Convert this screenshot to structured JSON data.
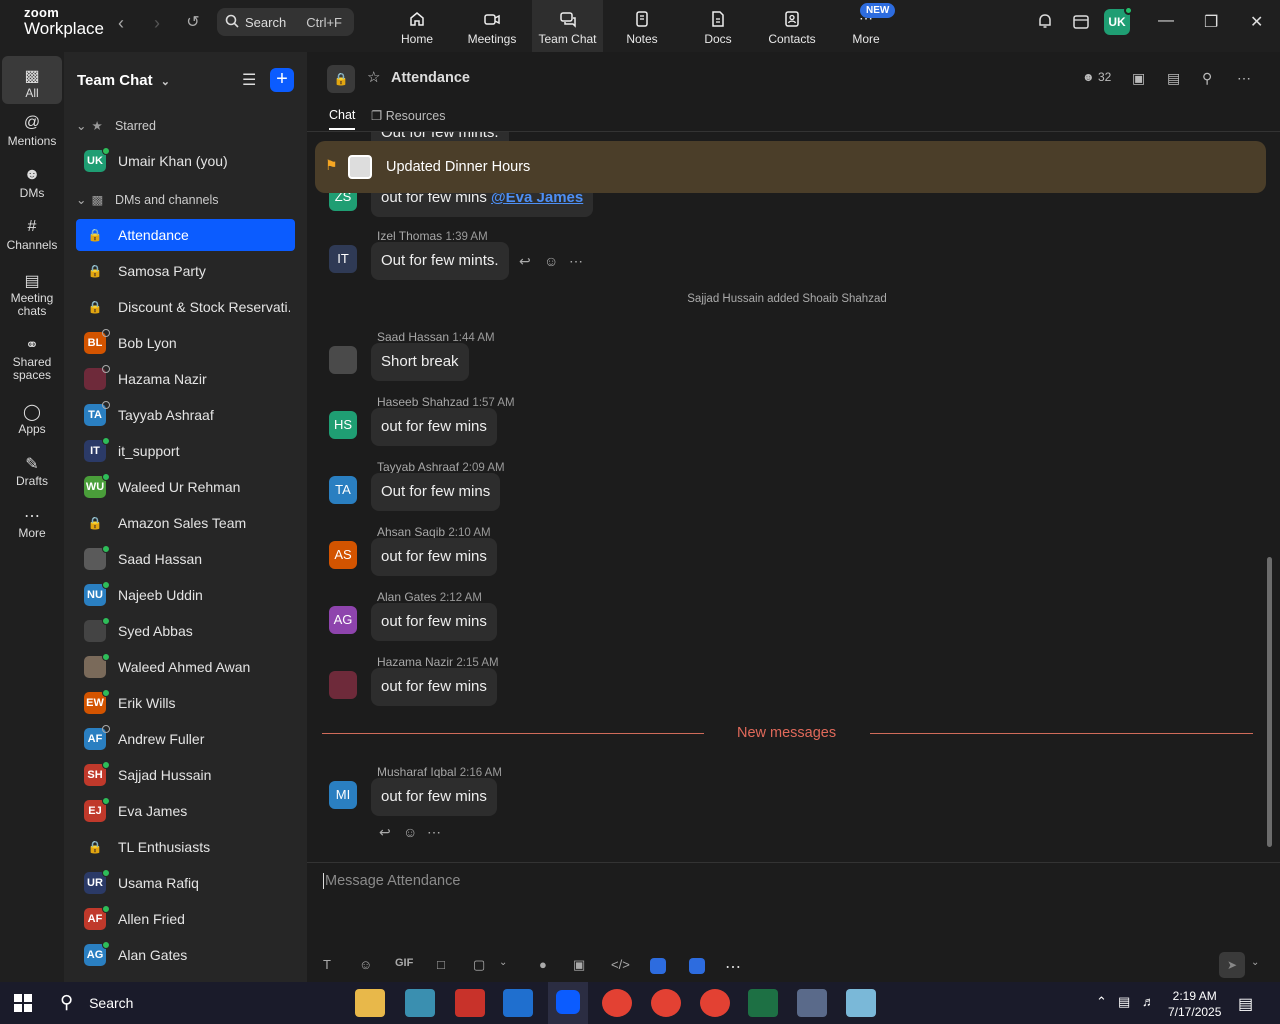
{
  "app": {
    "brand_line1": "zoom",
    "brand_line2": "Workplace",
    "search_label": "Search",
    "search_shortcut": "Ctrl+F",
    "tabs": [
      {
        "label": "Home",
        "icon": "home-icon"
      },
      {
        "label": "Meetings",
        "icon": "video-icon"
      },
      {
        "label": "Team Chat",
        "icon": "chat-icon"
      },
      {
        "label": "Notes",
        "icon": "notes-icon"
      },
      {
        "label": "Docs",
        "icon": "docs-icon"
      },
      {
        "label": "Contacts",
        "icon": "contacts-icon"
      },
      {
        "label": "More",
        "icon": "more-icon"
      }
    ],
    "new_badge": "NEW",
    "user_initials": "UK"
  },
  "rail": {
    "items": [
      {
        "label": "All",
        "icon": "chat-bubble-icon"
      },
      {
        "label": "Mentions",
        "icon": "at-icon"
      },
      {
        "label": "DMs",
        "icon": "people-icon"
      },
      {
        "label": "Channels",
        "icon": "hash-icon"
      },
      {
        "label": "Meeting chats",
        "icon": "calendar-icon"
      },
      {
        "label": "Shared spaces",
        "icon": "shared-icon"
      },
      {
        "label": "Apps",
        "icon": "apps-icon"
      },
      {
        "label": "Drafts",
        "icon": "drafts-icon"
      },
      {
        "label": "More",
        "icon": "ellipsis-icon"
      }
    ]
  },
  "sidebar": {
    "title": "Team Chat",
    "starred_label": "Starred",
    "dms_label": "DMs and channels",
    "starred": [
      {
        "name": "Umair Khan (you)",
        "initials": "UK",
        "color": "#1f9e73",
        "presence": "online"
      }
    ],
    "items": [
      {
        "name": "Attendance",
        "type": "channel",
        "active": true
      },
      {
        "name": "Samosa Party",
        "type": "channel"
      },
      {
        "name": "Discount & Stock Reservati...",
        "type": "channel"
      },
      {
        "name": "Bob Lyon",
        "initials": "BL",
        "color": "#d35400",
        "presence": "offline"
      },
      {
        "name": "Hazama Nazir",
        "initials": "",
        "color": "#6e2a3a",
        "presence": "offline"
      },
      {
        "name": "Tayyab Ashraaf",
        "initials": "TA",
        "color": "#2a7fc1",
        "presence": "offline"
      },
      {
        "name": "it_support",
        "initials": "IT",
        "color": "#2b3a67",
        "presence": "online"
      },
      {
        "name": "Waleed Ur Rehman",
        "initials": "WU",
        "color": "#4a9e3a",
        "presence": "online"
      },
      {
        "name": "Amazon Sales Team",
        "type": "channel"
      },
      {
        "name": "Saad Hassan",
        "initials": "",
        "color": "#5a5a5a",
        "presence": "online"
      },
      {
        "name": "Najeeb Uddin",
        "initials": "NU",
        "color": "#2a7fc1",
        "presence": "online"
      },
      {
        "name": "Syed Abbas",
        "initials": "",
        "color": "#444444",
        "presence": "online"
      },
      {
        "name": "Waleed Ahmed Awan",
        "initials": "",
        "color": "#7a6a5a",
        "presence": "online"
      },
      {
        "name": "Erik Wills",
        "initials": "EW",
        "color": "#d35400",
        "presence": "online"
      },
      {
        "name": "Andrew Fuller",
        "initials": "AF",
        "color": "#2a7fc1",
        "presence": "offline"
      },
      {
        "name": "Sajjad Hussain",
        "initials": "SH",
        "color": "#c0392b",
        "presence": "online"
      },
      {
        "name": "Eva James",
        "initials": "EJ",
        "color": "#c0392b",
        "presence": "online"
      },
      {
        "name": "TL Enthusiasts",
        "type": "channel"
      },
      {
        "name": "Usama Rafiq",
        "initials": "UR",
        "color": "#2b3a67",
        "presence": "online"
      },
      {
        "name": "Allen Fried",
        "initials": "AF",
        "color": "#c0392b",
        "presence": "online"
      },
      {
        "name": "Alan Gates",
        "initials": "AG",
        "color": "#2a7fc1",
        "presence": "online"
      }
    ]
  },
  "channel": {
    "title": "Attendance",
    "member_count": "32",
    "tab_chat": "Chat",
    "tab_resources": "Resources",
    "pinned": "Updated Dinner Hours",
    "partial_top": "Out for few mints.",
    "partial_mention_text": "out for few mins",
    "partial_mention": "@Eva James",
    "partial_initials": "ZS",
    "system_message": "Sajjad Hussain added Shoaib Shahzad",
    "new_messages_label": "New messages",
    "composer_placeholder": "Message Attendance",
    "messages": [
      {
        "sender": "Izel Thomas",
        "time": "1:39 AM",
        "text": "Out for few mints.",
        "initials": "IT",
        "color": "#2f3a55"
      },
      {
        "sender": "Saad Hassan",
        "time": "1:44 AM",
        "text": "Short break",
        "initials": "",
        "color": "#4a4a4a"
      },
      {
        "sender": "Haseeb Shahzad",
        "time": "1:57 AM",
        "text": "out for few mins",
        "initials": "HS",
        "color": "#1f9e73"
      },
      {
        "sender": "Tayyab Ashraaf",
        "time": "2:09 AM",
        "text": "Out for few mins",
        "initials": "TA",
        "color": "#2a7fc1"
      },
      {
        "sender": "Ahsan Saqib",
        "time": "2:10 AM",
        "text": "out for few mins",
        "initials": "AS",
        "color": "#d35400"
      },
      {
        "sender": "Alan Gates",
        "time": "2:12 AM",
        "text": "out for few mins",
        "initials": "AG",
        "color": "#8e44ad"
      },
      {
        "sender": "Hazama Nazir",
        "time": "2:15 AM",
        "text": "out for few mins",
        "initials": "",
        "color": "#6e2a3a"
      },
      {
        "sender": "Musharaf Iqbal",
        "time": "2:16 AM",
        "text": "out for few mins",
        "initials": "MI",
        "color": "#2a7fc1"
      }
    ]
  },
  "composer": {
    "gif_label": "GIF"
  },
  "taskbar": {
    "search_label": "Search",
    "time": "2:19 AM",
    "date": "7/17/2025"
  }
}
